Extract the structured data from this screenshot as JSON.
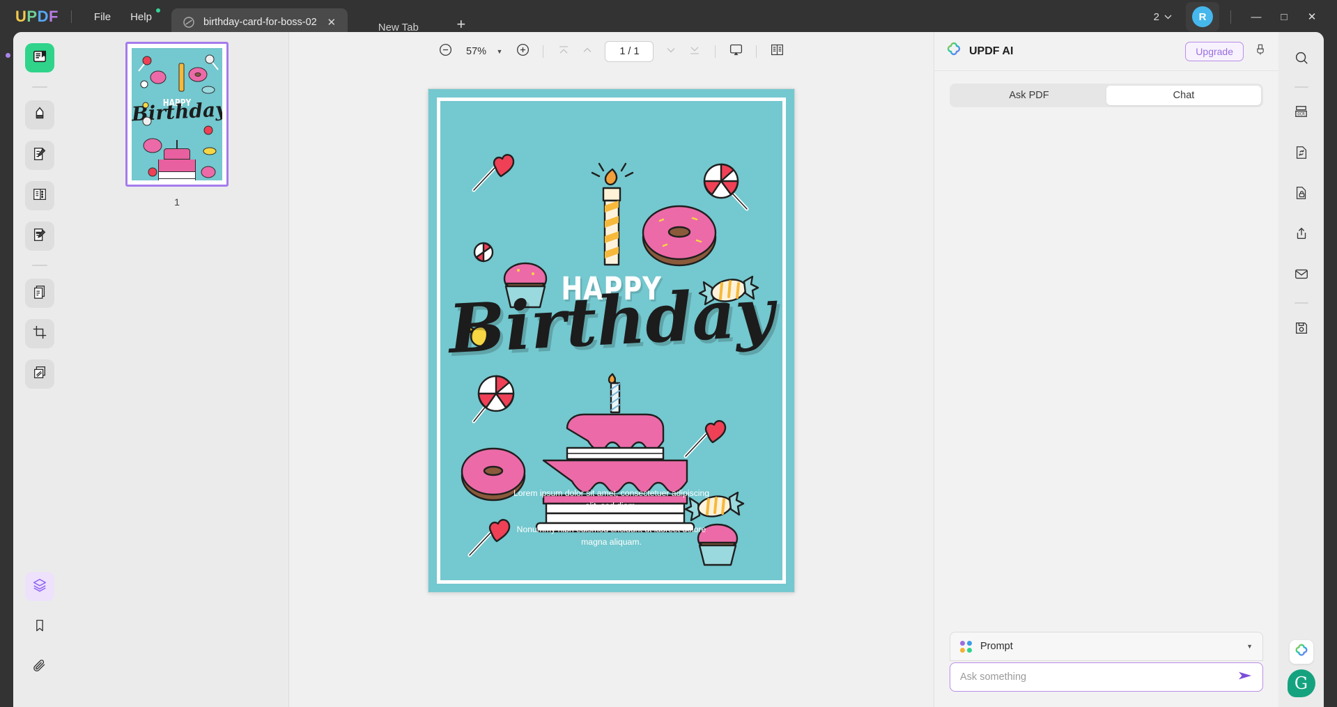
{
  "app": {
    "name": "UPDF",
    "logo_letters": [
      "U",
      "P",
      "D",
      "F"
    ],
    "accent_purple": "#a57bee",
    "accent_green": "#2fd48a"
  },
  "titlebar": {
    "menus": [
      {
        "label": "File",
        "has_dot": false
      },
      {
        "label": "Help",
        "has_dot": true
      }
    ],
    "tabs": [
      {
        "title": "birthday-card-for-boss-02",
        "close_label": "✕",
        "active": true
      }
    ],
    "new_tab_label": "New Tab",
    "new_tab_plus": "+",
    "tab_count": "2",
    "tab_count_caret": "⌄",
    "avatar_initial": "R",
    "window_controls": {
      "minimize": "—",
      "maximize": "□",
      "close": "✕"
    }
  },
  "left_rail": {
    "items": [
      {
        "name": "reader-tool",
        "icon": "book-reader-icon",
        "active": true
      },
      {
        "name": "annotate-tool",
        "icon": "highlighter-pen-icon",
        "active": false
      },
      {
        "name": "edit-pdf-tool",
        "icon": "document-pencil-icon",
        "active": false
      },
      {
        "name": "organize-pages-tool",
        "icon": "page-layout-icon",
        "active": false
      },
      {
        "name": "form-tool",
        "icon": "form-edit-icon",
        "active": false
      },
      {
        "name": "convert-tool",
        "icon": "document-copy-icon",
        "active": false
      },
      {
        "name": "crop-tool",
        "icon": "crop-icon",
        "active": false
      },
      {
        "name": "batch-tool",
        "icon": "stacked-pages-icon",
        "active": false
      }
    ],
    "bottom_items": [
      {
        "name": "layers-panel",
        "icon": "layers-icon",
        "active": true
      },
      {
        "name": "bookmarks-panel",
        "icon": "bookmark-icon",
        "active": false
      },
      {
        "name": "attachments-panel",
        "icon": "paperclip-icon",
        "active": false
      }
    ]
  },
  "thumbnails": {
    "pages": [
      {
        "label": "1",
        "selected": true
      }
    ]
  },
  "toolbar": {
    "zoom_out_icon": "minus-circle-icon",
    "zoom_value": "57%",
    "zoom_caret": "▼",
    "zoom_in_icon": "plus-circle-icon",
    "first_page_icon": "first-page-icon",
    "prev_page_icon": "previous-page-icon",
    "page_indicator": "1 / 1",
    "next_page_icon": "next-page-icon",
    "last_page_icon": "last-page-icon",
    "presentation_icon": "presentation-mode-icon",
    "view_mode_icon": "dual-page-view-icon"
  },
  "document": {
    "background_color": "#74c8cf",
    "border_color": "#ffffff",
    "heading_top": "HAPPY",
    "heading_script": "Birthday",
    "paragraphs": [
      "Lorem ipsum dolor sit amet, consectetuer adipiscing elit, sed diam.",
      "Nonummy nibh euismod tincidunt ut laoreet dolore magna aliquam."
    ],
    "decorations": [
      "heart-lollipop",
      "cupcake",
      "peppermint-candy",
      "birthday-candle",
      "pink-donut",
      "swirl-lollipop",
      "wrapped-candy",
      "yellow-candy",
      "birthday-cake"
    ]
  },
  "ai_panel": {
    "title": "UPDF AI",
    "logo_icon": "clover-ai-icon",
    "upgrade_label": "Upgrade",
    "brush_icon": "brush-icon",
    "tabs": [
      {
        "label": "Ask PDF",
        "selected": false
      },
      {
        "label": "Chat",
        "selected": true
      }
    ],
    "prompt_select_label": "Prompt",
    "prompt_select_caret": "▼",
    "input_placeholder": "Ask something",
    "input_value": "",
    "send_icon": "send-arrow-icon",
    "dot_colors": [
      "#9b6de0",
      "#3a9ced",
      "#f2b134",
      "#2fd48a"
    ]
  },
  "right_rail": {
    "items": [
      {
        "name": "search-button",
        "icon": "search-icon"
      },
      {
        "name": "ocr-button",
        "icon": "ocr-icon"
      },
      {
        "name": "convert-button",
        "icon": "document-convert-icon"
      },
      {
        "name": "protect-button",
        "icon": "document-lock-icon"
      },
      {
        "name": "share-button",
        "icon": "share-upload-icon"
      },
      {
        "name": "email-button",
        "icon": "envelope-icon"
      },
      {
        "name": "save-button",
        "icon": "floppy-save-icon"
      }
    ],
    "bottom_items": [
      {
        "name": "ai-assistant-button",
        "icon": "clover-ai-icon"
      },
      {
        "name": "grammarly-button",
        "icon": "grammarly-g-icon",
        "letter": "G"
      }
    ]
  }
}
